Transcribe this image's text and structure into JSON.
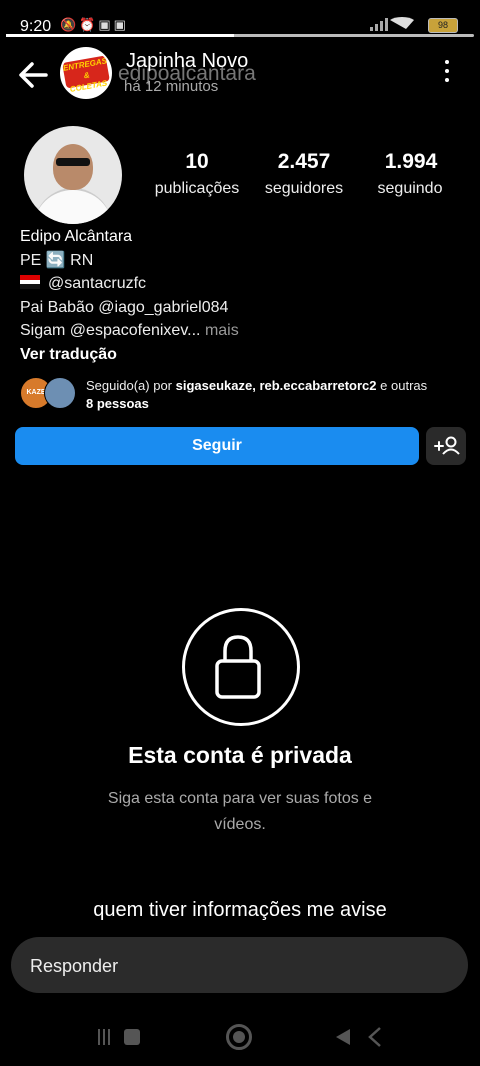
{
  "status_bar": {
    "time": "9:20",
    "left_icons": [
      "mute-icon",
      "alarm-icon",
      "app-icon",
      "app-icon-2"
    ],
    "battery": "98"
  },
  "story": {
    "username": "Japinha Novo",
    "username_overlay": "edipoalcantara",
    "time_ago": "há 12 minutos",
    "avatar_text": "ENTREGAS & COLETAS",
    "caption": "quem tiver informações me avise",
    "reply_placeholder": "Responder"
  },
  "profile": {
    "stats": [
      {
        "value": "10",
        "label": "publicações"
      },
      {
        "value": "2.457",
        "label": "seguidores"
      },
      {
        "value": "1.994",
        "label": "seguindo"
      }
    ],
    "name": "Edipo Alcântara",
    "bio_lines": {
      "line1_prefix": "PE",
      "line1_emoji": "🔄",
      "line1_suffix": "RN",
      "line2": "@santacruzfc",
      "line3": "Pai Babão @iago_gabriel084",
      "line4": "Sigam @espacofenixev...",
      "more": "mais"
    },
    "translate": "Ver tradução",
    "followed_by": {
      "prefix": "Seguido(a) por",
      "users": "sigaseukaze, reb.eccabarretorc2",
      "suffix": "e outras",
      "count": "8 pessoas",
      "avatar1_text": "KAZE"
    },
    "follow_button": "Seguir"
  },
  "private_account": {
    "title": "Esta conta é privada",
    "subtitle": "Siga esta conta para ver suas fotos e vídeos."
  },
  "colors": {
    "background": "#000000",
    "follow_button": "#1a8cf0",
    "reply_box": "#2b2b2b"
  }
}
